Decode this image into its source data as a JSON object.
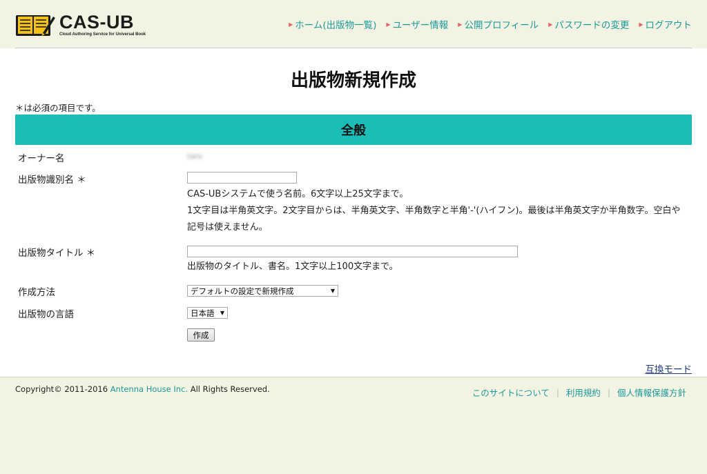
{
  "header": {
    "logo_title": "CAS-UB",
    "logo_subtitle": "Cloud Authoring Service for Universal Book",
    "nav": [
      {
        "label": "ホーム(出版物一覧)"
      },
      {
        "label": "ユーザー情報"
      },
      {
        "label": "公開プロフィール"
      },
      {
        "label": "パスワードの変更"
      },
      {
        "label": "ログアウト"
      }
    ]
  },
  "page": {
    "title": "出版物新規作成",
    "required_note": "＊は必須の項目です。",
    "section_title": "全般"
  },
  "form": {
    "owner": {
      "label": "オーナー名",
      "value": "taro"
    },
    "identifier": {
      "label": "出版物識別名 ＊",
      "value": "",
      "help1": "CAS-UBシステムで使う名前。6文字以上25文字まで。",
      "help2": "1文字目は半角英文字。2文字目からは、半角英文字、半角数字と半角'-'(ハイフン)。最後は半角英文字か半角数字。空白や記号は使えません。"
    },
    "title_field": {
      "label": "出版物タイトル ＊",
      "value": "",
      "help": "出版物のタイトル、書名。1文字以上100文字まで。"
    },
    "method": {
      "label": "作成方法",
      "selected": "デフォルトの設定で新規作成"
    },
    "language": {
      "label": "出版物の言語",
      "selected": "日本語"
    },
    "submit_label": "作成"
  },
  "compat_mode": "互換モード",
  "footer": {
    "copyright_prefix": "Copyright© 2011-2016 ",
    "copyright_company": "Antenna House Inc.",
    "copyright_suffix": " All Rights Reserved.",
    "links": [
      {
        "label": "このサイトについて"
      },
      {
        "label": "利用規約"
      },
      {
        "label": "個人情報保護方針"
      }
    ]
  },
  "colors": {
    "accent": "#1cbdb6",
    "link": "#1b9a9a",
    "nav_bullet": "#e06565",
    "header_bg": "#f3f3e4"
  }
}
